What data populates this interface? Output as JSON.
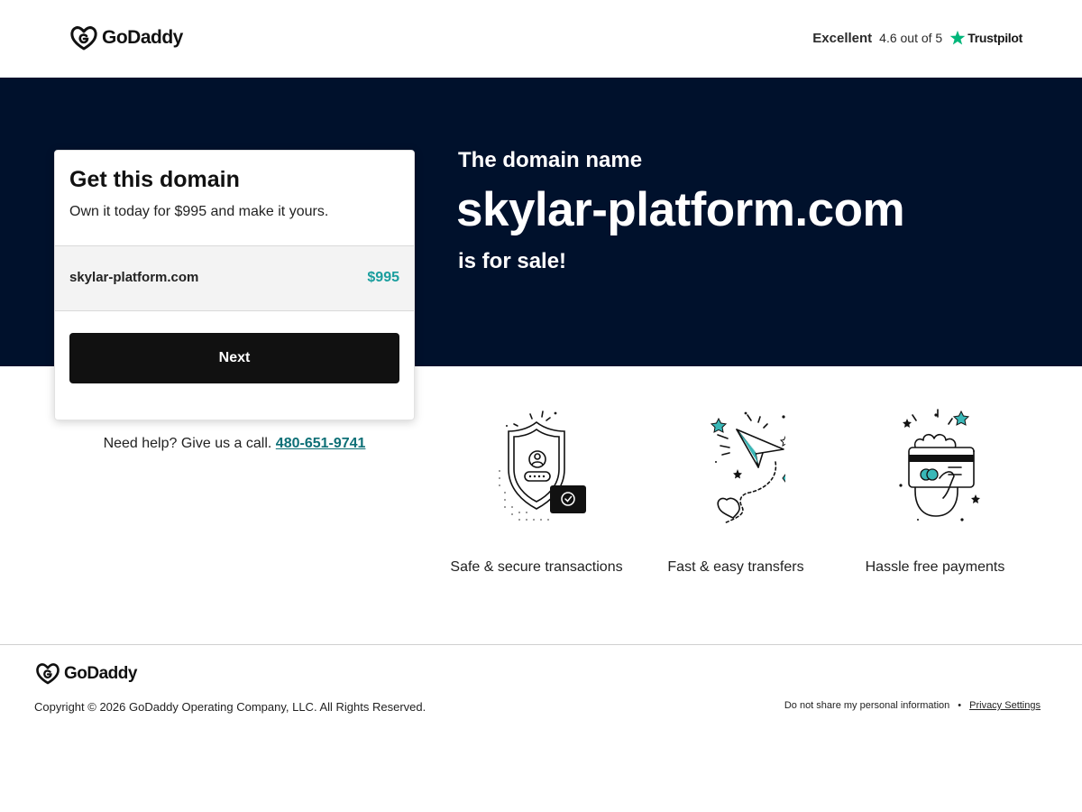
{
  "header": {
    "logo_text": "GoDaddy",
    "rating_label": "Excellent",
    "rating_score": "4.6 out of 5",
    "trustpilot": "Trustpilot"
  },
  "hero": {
    "subtitle": "The domain name",
    "domain": "skylar-platform.com",
    "status": "is for sale!"
  },
  "card": {
    "title": "Get this domain",
    "subtitle": "Own it today for $995 and make it yours.",
    "domain": "skylar-platform.com",
    "price": "$995",
    "next_label": "Next"
  },
  "help": {
    "text": "Need help? Give us a call.",
    "phone": "480-651-9741"
  },
  "features": [
    {
      "label": "Safe & secure transactions",
      "icon": "shield-icon"
    },
    {
      "label": "Fast & easy transfers",
      "icon": "paper-plane-icon"
    },
    {
      "label": "Hassle free payments",
      "icon": "card-in-hand-icon"
    }
  ],
  "footer": {
    "logo_text": "GoDaddy",
    "copyright": "Copyright © 2026 GoDaddy Operating Company, LLC. All Rights Reserved.",
    "do_not_share": "Do not share my personal information",
    "separator": "•",
    "privacy": "Privacy Settings"
  },
  "colors": {
    "hero_bg": "#00112c",
    "accent": "#1a9e9e",
    "button": "#111111",
    "trustpilot_star": "#00b67a"
  }
}
